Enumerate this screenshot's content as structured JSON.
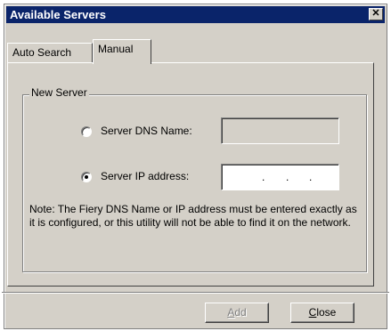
{
  "window": {
    "title": "Available Servers"
  },
  "tabs": [
    {
      "label": "Auto Search",
      "active": false
    },
    {
      "label": "Manual",
      "active": true
    }
  ],
  "group": {
    "label": "New Server"
  },
  "options": {
    "dns": {
      "label": "Server DNS Name:",
      "selected": false,
      "value": ""
    },
    "ip": {
      "label": "Server IP address:",
      "selected": true,
      "dots": [
        ".",
        ".",
        "."
      ]
    }
  },
  "note": "Note:  The Fiery DNS Name or IP address must be entered exactly as it is configured, or this utility will not be able to find it on the network.",
  "buttons": {
    "add": {
      "first": "A",
      "rest": "dd",
      "enabled": false
    },
    "close": {
      "first": "C",
      "rest": "lose",
      "enabled": true
    }
  },
  "colors": {
    "titlebar": "#0a246a",
    "face": "#d4d0c8"
  }
}
